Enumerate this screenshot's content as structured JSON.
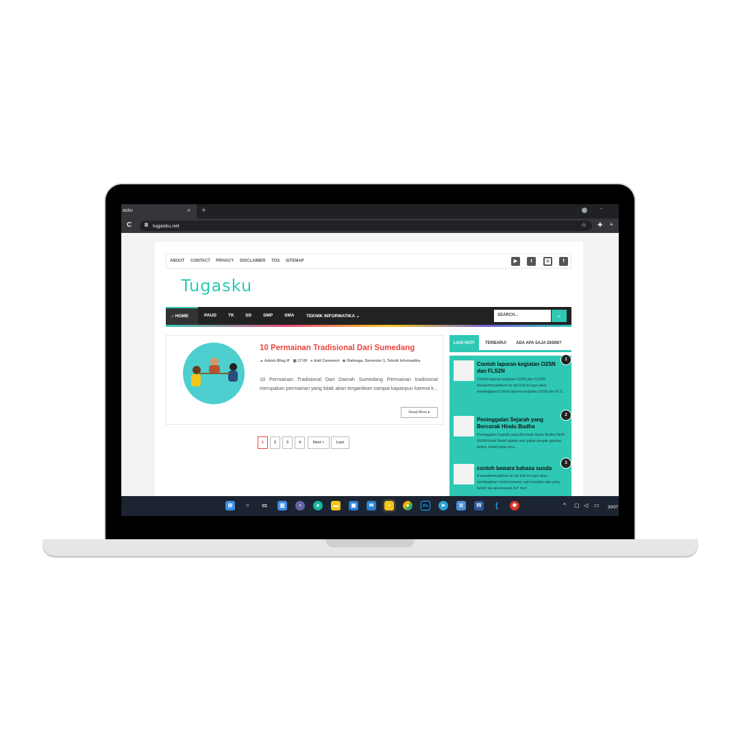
{
  "browser": {
    "tab_title": "asku",
    "tab_close": "×",
    "new_tab": "+",
    "url": "tugasku.net",
    "reload_icon": "C",
    "bookmark_star": "☆",
    "extensions_icon": "✚",
    "tab_search_icon": "≡"
  },
  "topnav": {
    "items": [
      "ABOUT",
      "CONTACT",
      "PRIVACY",
      "DISCLAIMER",
      "TOS",
      "SITEMAP"
    ],
    "social": [
      "youtube-icon",
      "twitter-icon",
      "instagram-icon",
      "facebook-icon"
    ]
  },
  "logo": {
    "text": "Tugasku",
    "color": "#2ec8b4"
  },
  "mainnav": {
    "home": "HOME",
    "items": [
      "PAUD",
      "TK",
      "SD",
      "SMP",
      "SMA",
      "TEKNIK INFORMATIKA"
    ],
    "search_placeholder": "SEARCH...",
    "accent": "#2ec8b4"
  },
  "post": {
    "title": "10 Permainan Tradisional Dari Sumedang",
    "author": "Admin Blog IF",
    "time": "17:00",
    "comment": "Add Comment",
    "labels": "Olahraga, Semester 1, Teknik Informatika",
    "excerpt": "10 Permainan Tradisional Dari Daerah Sumedang Permainan tradisional merupakan permainan yang tidak akan tergantikan sampai kapanpun karena k...",
    "read_more": "Read More"
  },
  "pagination": {
    "pages": [
      "1",
      "2",
      "3",
      "4"
    ],
    "next": "Next »",
    "last": "Last",
    "current": "1"
  },
  "sidebar": {
    "tabs": [
      "LAGI HOT!",
      "TERBARU!",
      "ADA APA SAJA DISINI?"
    ],
    "items": [
      {
        "num": "1",
        "title": "Contoh laporan kegiatan O2SN dan FLS2N",
        "excerpt": "Contoh laporan kegiatan O2SN dan FLS2N Assalammualaikum wr wb Kali ini saya akan membagikan Contoh laporan kegiatan O2SN dan FLS..."
      },
      {
        "num": "2",
        "title": "Peninggalan Sejarah yang Bercorak Hindu Budha",
        "excerpt": "Peninggalan Sejarah yang Bercorak Hindu Budha SENI RUPA Relief Relief adalah seni pahat dengan gambar timbul. Relief pada umu..."
      },
      {
        "num": "3",
        "title": "contoh bewara bahasa sunda",
        "excerpt": "A ssaalammualikum wr wb Kali ini saya akan membagikan contoh bewara, nah mungkin ada yang belum tau apa bewara itu? mari"
      }
    ]
  },
  "taskbar": {
    "clock": "30/07",
    "icons": [
      "windows-start-icon",
      "search-icon",
      "task-view-icon",
      "widgets-icon",
      "teams-icon",
      "edge-icon",
      "file-explorer-icon",
      "store-icon",
      "mail-icon",
      "sticky-notes-icon",
      "chrome-icon",
      "photoshop-icon",
      "telegram-icon",
      "notepad-icon",
      "word-icon",
      "vscode-icon",
      "app-icon"
    ]
  }
}
